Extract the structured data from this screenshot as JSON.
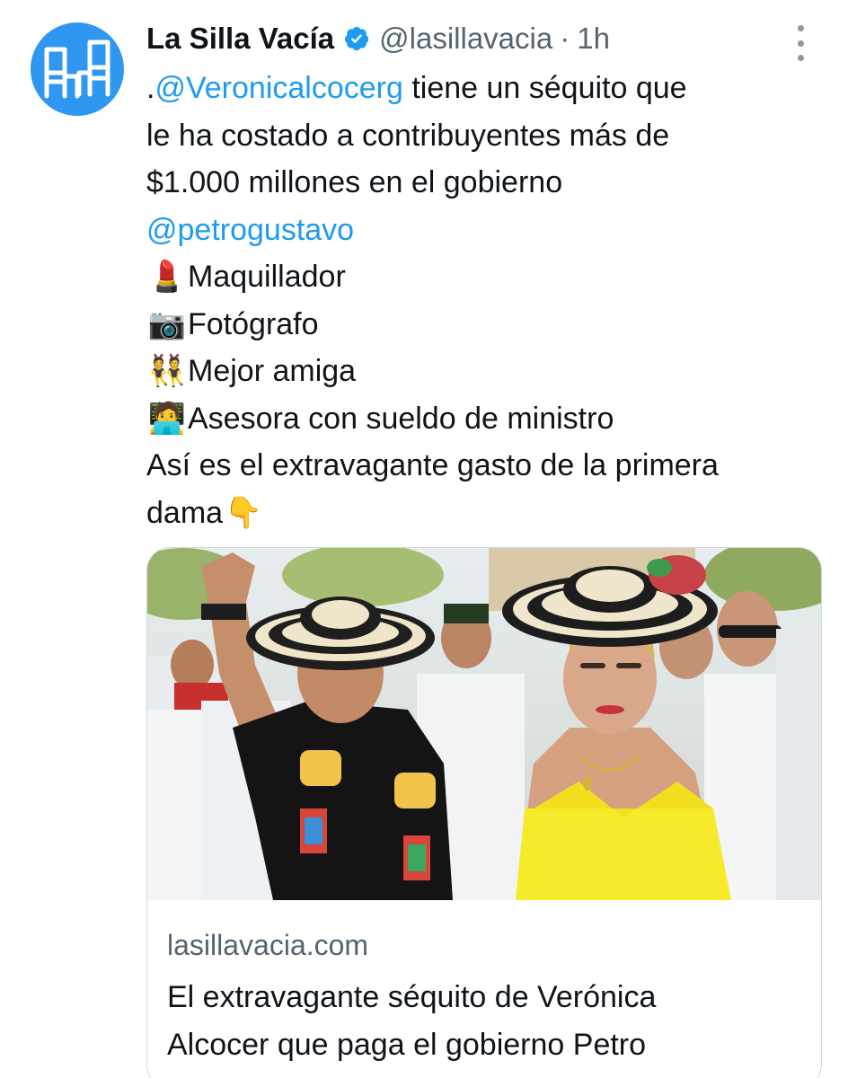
{
  "tweet": {
    "author": {
      "display_name": "La Silla Vacía",
      "handle": "@lasillavacia",
      "verified": true,
      "avatar_icon": "two-chairs-logo-icon",
      "avatar_color": "#2f97f0"
    },
    "separator": "·",
    "time": "1h",
    "more_icon": "more-options-icon",
    "text_lines": [
      {
        "prefix": ".",
        "mention": "@Veronicalcocerg",
        "text": " tiene un séquito que"
      },
      {
        "text": "le ha costado a contribuyentes más de"
      },
      {
        "text": "$1.000 millones en el gobierno"
      },
      {
        "mention": "@petrogustavo"
      },
      {
        "emoji": "💄",
        "text": "Maquillador"
      },
      {
        "emoji": "📷",
        "text": "Fotógrafo"
      },
      {
        "emoji": "👯",
        "text": "Mejor amiga"
      },
      {
        "emoji": "🧑‍💻",
        "text": "Asesora con sueldo de ministro"
      },
      {
        "text": "Así es el extravagante gasto de la primera"
      },
      {
        "text": "dama",
        "emoji_after": "👇"
      }
    ],
    "card": {
      "domain": "lasillavacia.com",
      "title_lines": [
        "El extravagante séquito de Verónica",
        "Alcocer que paga el gobierno Petro"
      ]
    }
  },
  "colors": {
    "link": "#1d9bf0",
    "secondary_text": "#536471",
    "verified": "#1d9bf0",
    "card_border": "#cfd9de"
  }
}
